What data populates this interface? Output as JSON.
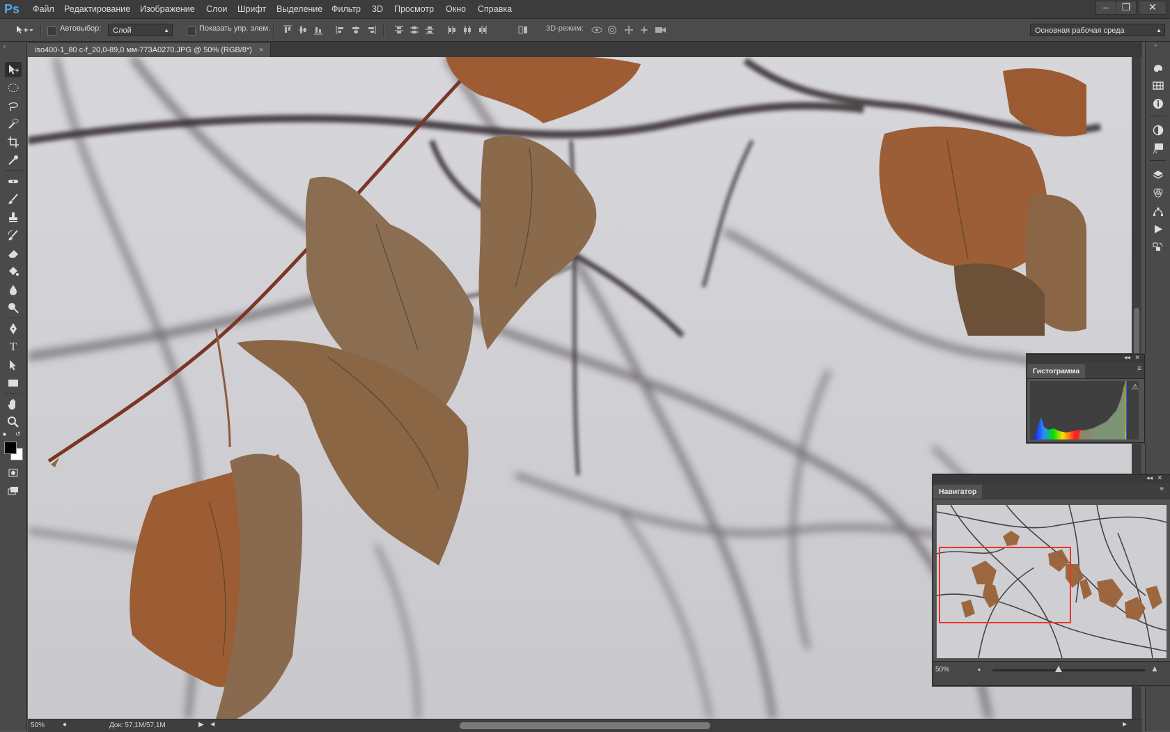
{
  "app": {
    "logo": "Ps"
  },
  "menu": {
    "items": [
      "Файл",
      "Редактирование",
      "Изображение",
      "Слои",
      "Шрифт",
      "Выделение",
      "Фильтр",
      "3D",
      "Просмотр",
      "Окно",
      "Справка"
    ]
  },
  "window_controls": {
    "minimize": "–",
    "restore": "❐",
    "close": "✕"
  },
  "options": {
    "autoselect_label": "Автовыбор:",
    "autoselect_value": "Слой",
    "show_transform_label": "Показать упр. элем.",
    "mode3d_label": "3D-режим:",
    "workspace_value": "Основная рабочая среда"
  },
  "document": {
    "tab_title": "iso400-1_80 c-f_20,0-89,0 мм-773A0270.JPG @ 50% (RGB/8*)",
    "tab_close": "×"
  },
  "tools": [
    "move-icon",
    "marquee-icon",
    "lasso-icon",
    "quick-select-icon",
    "crop-icon",
    "eyedropper-icon",
    "healing-icon",
    "brush-icon",
    "stamp-icon",
    "history-brush-icon",
    "eraser-icon",
    "paint-bucket-icon",
    "blur-icon",
    "dodge-icon",
    "pen-icon",
    "type-icon",
    "path-select-icon",
    "rectangle-icon",
    "hand-icon",
    "zoom-icon"
  ],
  "tool_type_glyph": "T",
  "dock_icons": [
    "color-icon",
    "swatches-icon",
    "info-icon",
    "adjustments-icon",
    "styles-icon",
    "layers-icon",
    "channels-icon",
    "paths-icon",
    "actions-icon",
    "history-icon"
  ],
  "histogram_panel": {
    "title": "Гистограмма",
    "warning": "⚠"
  },
  "navigator_panel": {
    "title": "Навигатор",
    "zoom": "50%"
  },
  "status": {
    "zoom": "50%",
    "doc": "Док: 57,1M/57,1M"
  },
  "colors": {
    "accent": "#4fa7e8",
    "nav_rect": "#e8342a",
    "foreground": "#000000",
    "background": "#ffffff"
  }
}
